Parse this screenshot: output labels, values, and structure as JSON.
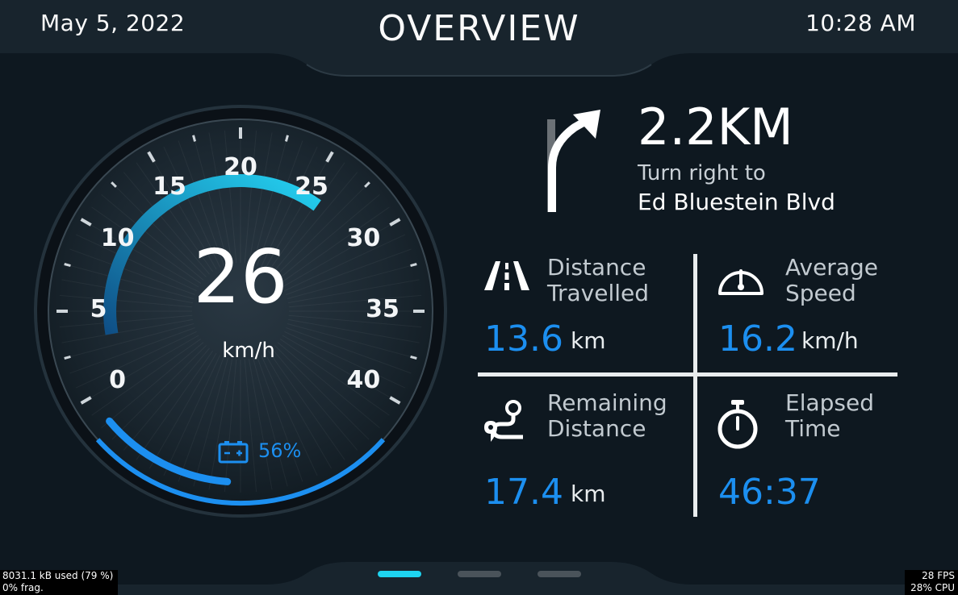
{
  "header": {
    "date": "May 5, 2022",
    "title": "OVERVIEW",
    "time": "10:28 AM"
  },
  "speedometer": {
    "speed": "26",
    "unit": "km/h",
    "scale": [
      "0",
      "5",
      "10",
      "15",
      "20",
      "25",
      "30",
      "35",
      "40"
    ],
    "speed_fraction": 0.65,
    "battery_icon": "battery-icon",
    "battery_percent": "56%",
    "battery_fraction": 0.56,
    "accent_color": "#1c8ff0",
    "arc_color": "#1ed4f0"
  },
  "navigation": {
    "icon": "turn-right-arrow-icon",
    "distance": "2.2KM",
    "instruction": "Turn right to",
    "street": "Ed Bluestein Blvd"
  },
  "stats": {
    "distance_travelled": {
      "icon": "road-icon",
      "label_line1": "Distance",
      "label_line2": "Travelled",
      "value": "13.6",
      "unit": "km"
    },
    "average_speed": {
      "icon": "gauge-icon",
      "label_line1": "Average",
      "label_line2": "Speed",
      "value": "16.2",
      "unit": "km/h"
    },
    "remaining_distance": {
      "icon": "route-icon",
      "label_line1": "Remaining",
      "label_line2": "Distance",
      "value": "17.4",
      "unit": "km"
    },
    "elapsed_time": {
      "icon": "stopwatch-icon",
      "label_line1": "Elapsed",
      "label_line2": "Time",
      "value": "46:37"
    }
  },
  "pagination": {
    "count": 3,
    "active": 1
  },
  "perf": {
    "memory": "8031.1 kB used (79 %)",
    "frag": "0% frag.",
    "fps": "28 FPS",
    "cpu": "28% CPU"
  }
}
